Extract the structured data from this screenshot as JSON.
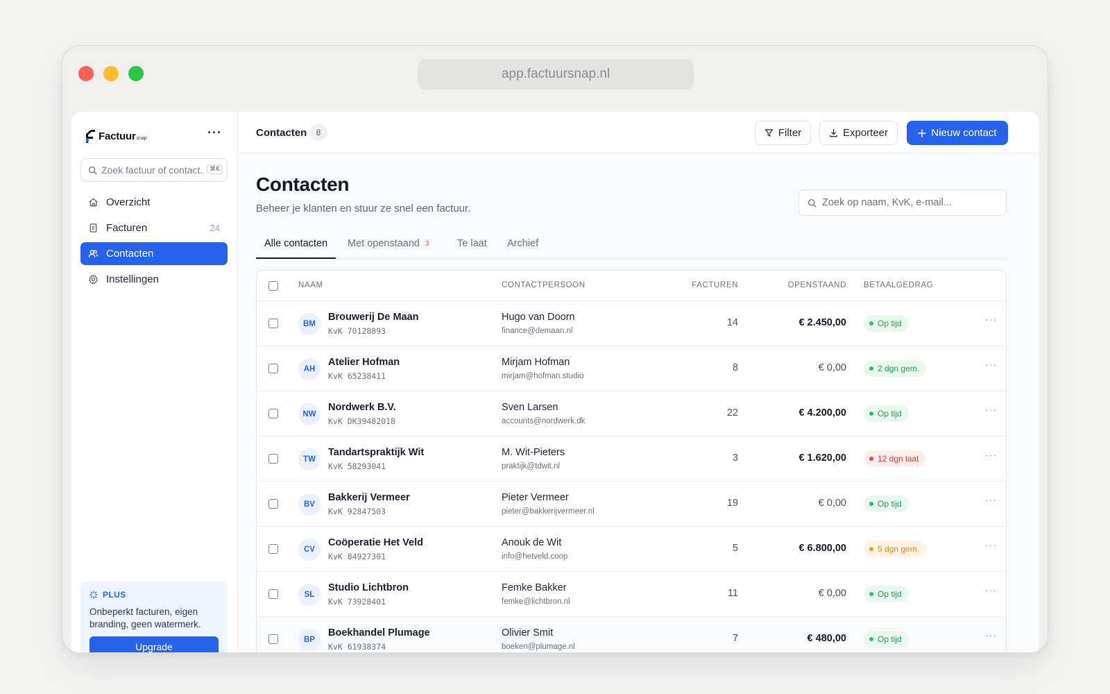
{
  "browser": {
    "url": "app.factuursnap.nl"
  },
  "brand": {
    "name": "Factuur",
    "suffix": "snap"
  },
  "sidebar": {
    "more": "···",
    "search_placeholder": "Zoek factuur of contact...",
    "shortcut": "⌘K",
    "items": [
      {
        "label": "Overzicht",
        "icon": "home-icon",
        "count": ""
      },
      {
        "label": "Facturen",
        "icon": "receipt-icon",
        "count": "24"
      },
      {
        "label": "Contacten",
        "icon": "users-icon",
        "count": "",
        "active": true
      },
      {
        "label": "Instellingen",
        "icon": "gear-icon",
        "count": ""
      }
    ],
    "plus": {
      "title": "PLUS",
      "text": "Onbeperkt facturen, eigen branding, geen watermerk.",
      "button": "Upgrade"
    }
  },
  "topbar": {
    "title": "Contacten",
    "count": "8",
    "filter_label": "Filter",
    "export_label": "Exporteer",
    "new_label": "Nieuw contact"
  },
  "page": {
    "title": "Contacten",
    "subtitle": "Beheer je klanten en stuur ze snel een factuur.",
    "search_placeholder": "Zoek op naam, KvK, e-mail..."
  },
  "tabs": [
    {
      "label": "Alle contacten",
      "badge": ""
    },
    {
      "label": "Met openstaand",
      "badge": "3"
    },
    {
      "label": "Te laat",
      "badge": ""
    },
    {
      "label": "Archief",
      "badge": ""
    }
  ],
  "table": {
    "headers": {
      "name": "NAAM",
      "contact": "CONTACTPERSOON",
      "invoices": "FACTUREN",
      "outstanding": "OPENSTAAND",
      "payment": "BETAALGEDRAG"
    },
    "rows": [
      {
        "initials": "BM",
        "name": "Brouwerij De Maan",
        "kvk": "KvK 70128893",
        "person": "Hugo van Doorn",
        "email": "finance@demaan.nl",
        "invoices": "14",
        "amount": "€ 2.450,00",
        "status": "Op tijd"
      },
      {
        "initials": "AH",
        "name": "Atelier Hofman",
        "kvk": "KvK 65238411",
        "person": "Mirjam Hofman",
        "email": "mirjam@hofman.studio",
        "invoices": "8",
        "amount": "€ 0,00",
        "status": "2 dgn gem."
      },
      {
        "initials": "NW",
        "name": "Nordwerk B.V.",
        "kvk": "KvK DK39482018",
        "person": "Sven Larsen",
        "email": "accounts@nordwerk.dk",
        "invoices": "22",
        "amount": "€ 4.200,00",
        "status": "Op tijd"
      },
      {
        "initials": "TW",
        "name": "Tandartspraktijk Wit",
        "kvk": "KvK 58293041",
        "person": "M. Wit-Pieters",
        "email": "praktijk@tdwit.nl",
        "invoices": "3",
        "amount": "€ 1.620,00",
        "status": "12 dgn laat"
      },
      {
        "initials": "BV",
        "name": "Bakkerij Vermeer",
        "kvk": "KvK 92847503",
        "person": "Pieter Vermeer",
        "email": "pieter@bakkerijvermeer.nl",
        "invoices": "19",
        "amount": "€ 0,00",
        "status": "Op tijd"
      },
      {
        "initials": "CV",
        "name": "Coöperatie Het Veld",
        "kvk": "KvK 84927301",
        "person": "Anouk de Wit",
        "email": "info@hetveld.coop",
        "invoices": "5",
        "amount": "€ 6.800,00",
        "status": "5 dgn gem."
      },
      {
        "initials": "SL",
        "name": "Studio Lichtbron",
        "kvk": "KvK 73928401",
        "person": "Femke Bakker",
        "email": "femke@lichtbron.nl",
        "invoices": "11",
        "amount": "€ 0,00",
        "status": "Op tijd"
      },
      {
        "initials": "BP",
        "name": "Boekhandel Plumage",
        "kvk": "KvK 61938374",
        "person": "Olivier Smit",
        "email": "boeken@plumage.nl",
        "invoices": "7",
        "amount": "€ 480,00",
        "status": "Op tijd"
      }
    ],
    "row_more": "···"
  },
  "colors": {
    "accent": "#2563eb",
    "status_green": "#1f9d55",
    "status_red": "#dc3a3a",
    "status_orange": "#e08a1a"
  }
}
